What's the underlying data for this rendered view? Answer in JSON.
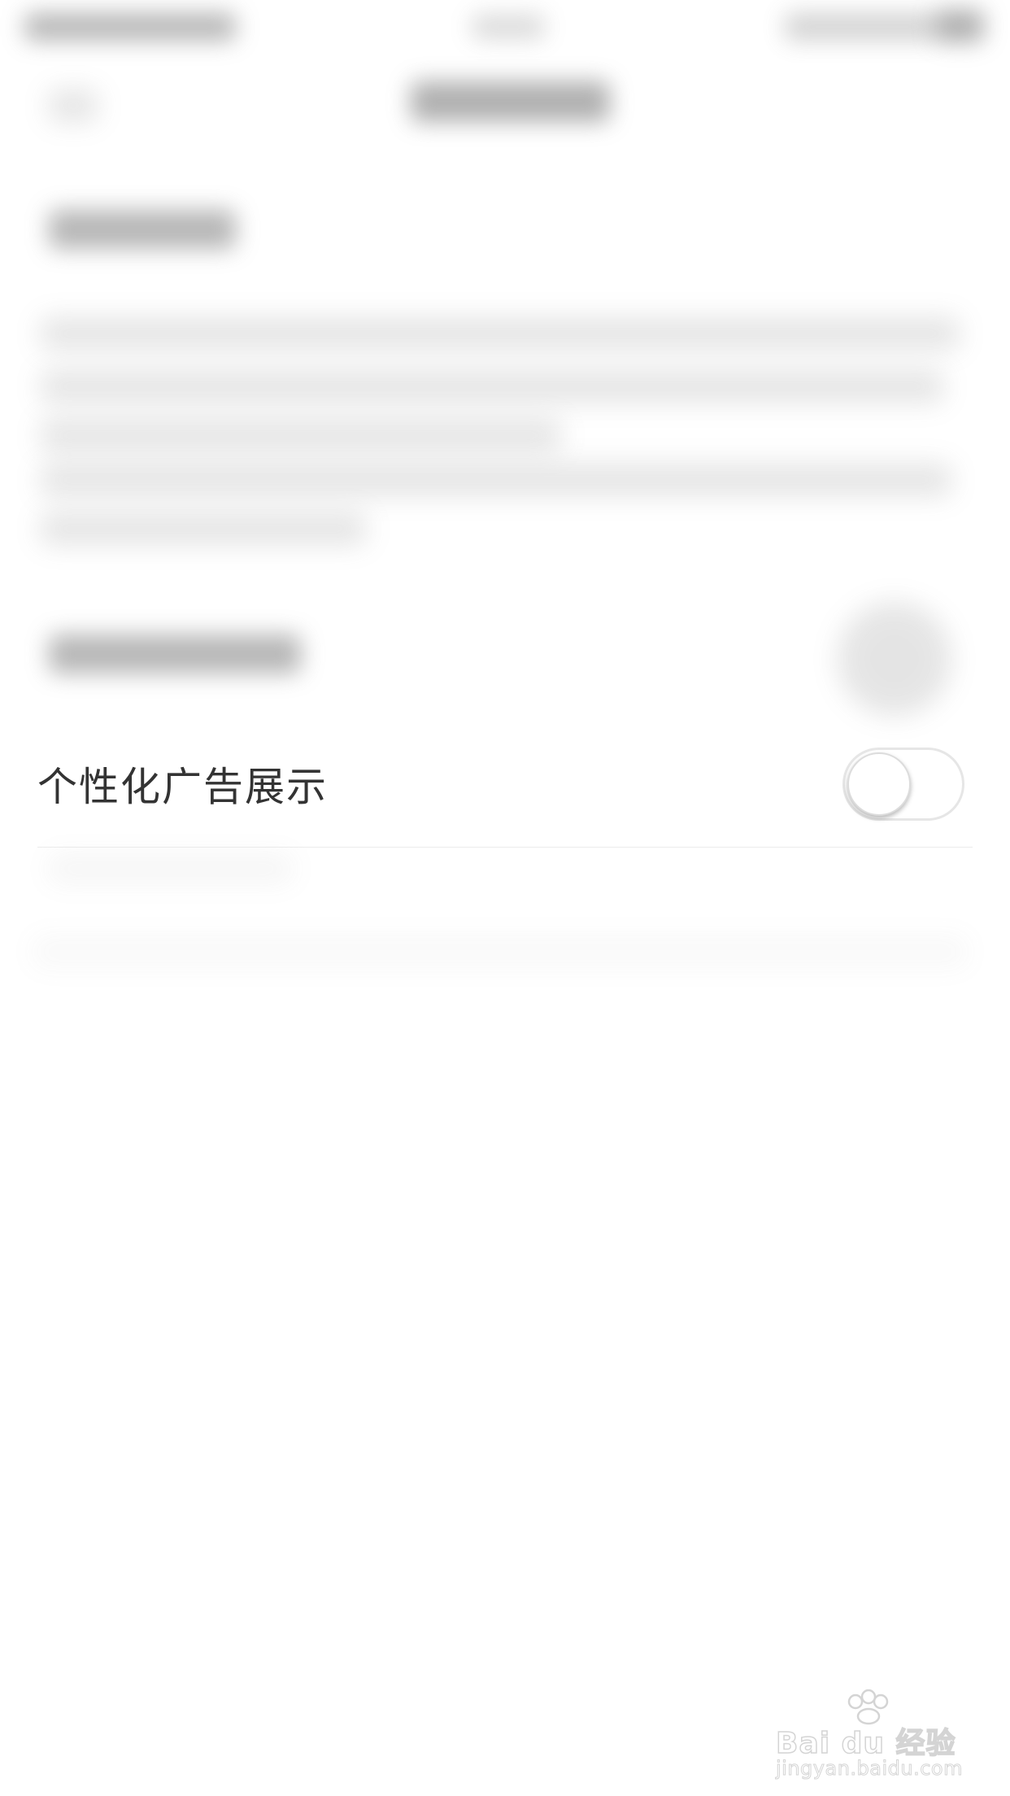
{
  "setting": {
    "label": "个性化广告展示",
    "toggle_on": false
  },
  "watermark": {
    "brand_text": "Bai du 经验",
    "url_text": "jingyan.baidu.com"
  },
  "colors": {
    "background": "#ffffff",
    "label_text": "#333333",
    "toggle_border": "#e6e6e6",
    "divider": "#ececec"
  }
}
